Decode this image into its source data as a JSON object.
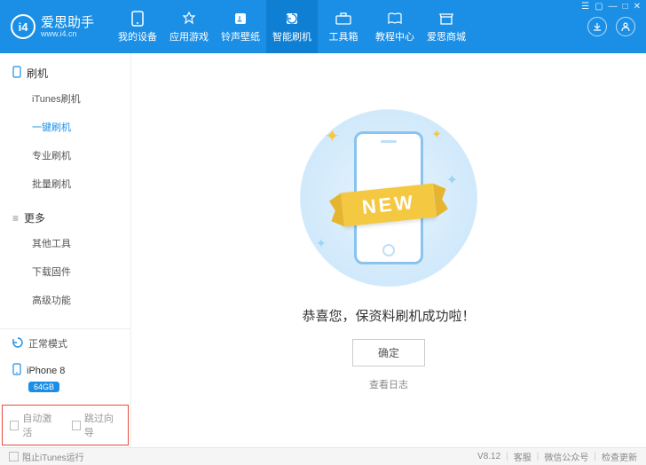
{
  "header": {
    "logo_text": "爱思助手",
    "logo_sub": "www.i4.cn",
    "logo_mark": "i4",
    "nav": [
      {
        "label": "我的设备",
        "icon": "phone"
      },
      {
        "label": "应用游戏",
        "icon": "apps"
      },
      {
        "label": "铃声壁纸",
        "icon": "music"
      },
      {
        "label": "智能刷机",
        "icon": "flash",
        "active": true
      },
      {
        "label": "工具箱",
        "icon": "toolbox"
      },
      {
        "label": "教程中心",
        "icon": "book"
      },
      {
        "label": "爱思商城",
        "icon": "shop"
      }
    ],
    "download_icon": "download",
    "user_icon": "user"
  },
  "sidebar": {
    "section1": {
      "title": "刷机",
      "icon": "phone-icon"
    },
    "items1": [
      {
        "label": "iTunes刷机"
      },
      {
        "label": "一键刷机",
        "active": true
      },
      {
        "label": "专业刷机"
      },
      {
        "label": "批量刷机"
      }
    ],
    "section2": {
      "title": "更多",
      "icon": "more-icon"
    },
    "items2": [
      {
        "label": "其他工具"
      },
      {
        "label": "下载固件"
      },
      {
        "label": "高级功能"
      }
    ],
    "mode": {
      "label": "正常模式",
      "icon": "refresh"
    },
    "device": {
      "name": "iPhone 8",
      "storage": "64GB",
      "icon": "phone"
    },
    "auto_activate": "自动激活",
    "skip_wizard": "跳过向导"
  },
  "main": {
    "ribbon": "NEW",
    "success_text": "恭喜您，保资料刷机成功啦！",
    "confirm": "确定",
    "log_link": "查看日志"
  },
  "footer": {
    "block_itunes": "阻止iTunes运行",
    "version": "V8.12",
    "links": [
      "客服",
      "微信公众号",
      "检查更新"
    ]
  }
}
